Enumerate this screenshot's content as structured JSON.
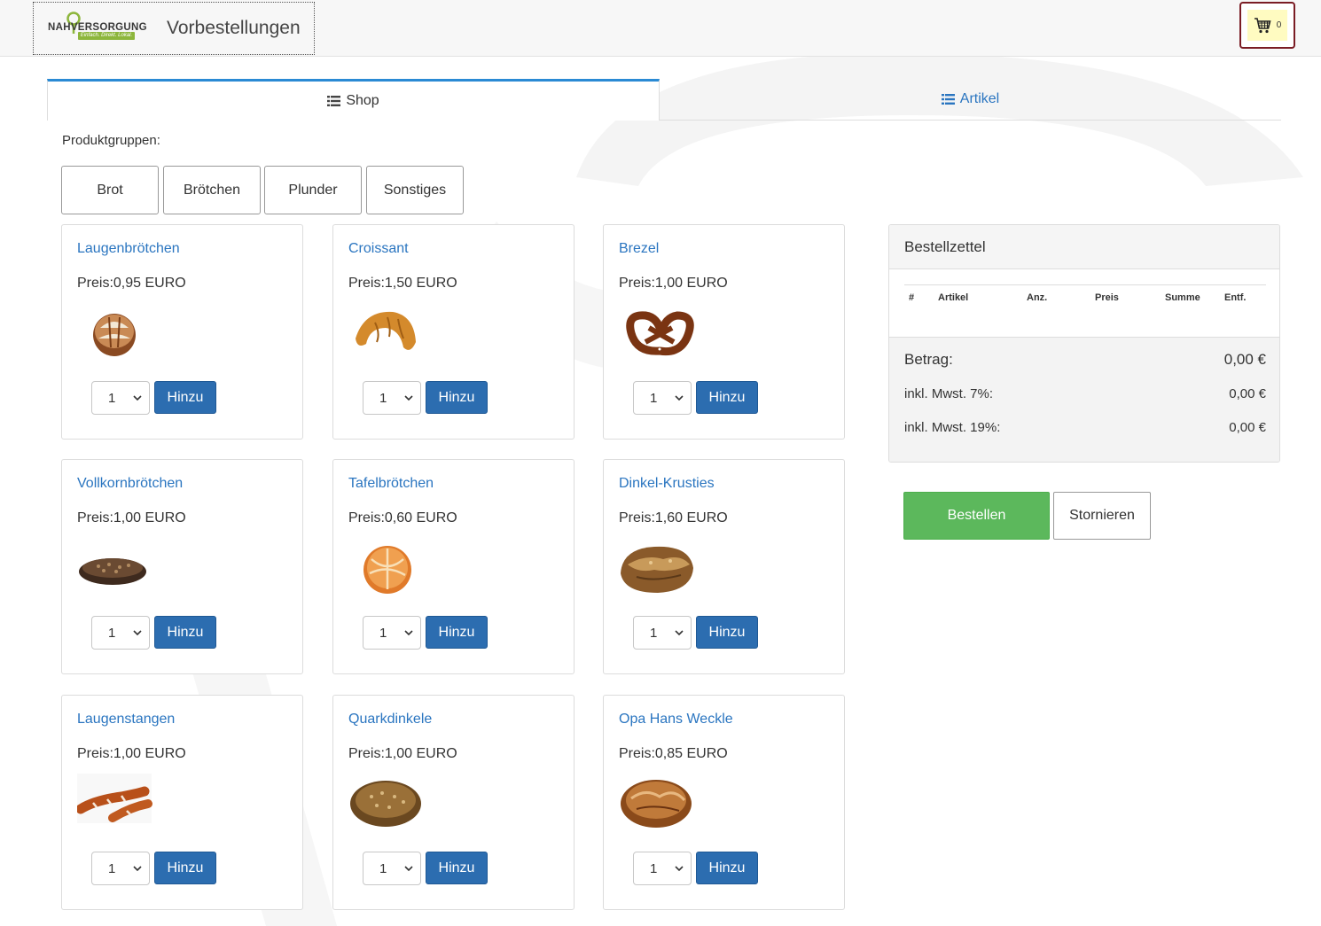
{
  "header": {
    "logo_text": "NAHVERSORGUNG",
    "logo_tagline": "Einfach. Direkt. Lokal.",
    "title": "Vorbestellungen",
    "cart_count": "0"
  },
  "tabs": [
    {
      "label": "Shop",
      "active": true
    },
    {
      "label": "Artikel",
      "active": false
    }
  ],
  "groups": {
    "label": "Produktgruppen:",
    "items": [
      "Brot",
      "Brötchen",
      "Plunder",
      "Sonstiges"
    ]
  },
  "products": [
    {
      "name": "Laugenbrötchen",
      "price": "Preis:0,95 EURO",
      "qty": "1",
      "add_label": "Hinzu",
      "image": "laugenbroetchen"
    },
    {
      "name": "Croissant",
      "price": "Preis:1,50 EURO",
      "qty": "1",
      "add_label": "Hinzu",
      "image": "croissant"
    },
    {
      "name": "Brezel",
      "price": "Preis:1,00 EURO",
      "qty": "1",
      "add_label": "Hinzu",
      "image": "brezel"
    },
    {
      "name": "Vollkornbrötchen",
      "price": "Preis:1,00 EURO",
      "qty": "1",
      "add_label": "Hinzu",
      "image": "vollkornbroetchen"
    },
    {
      "name": "Tafelbrötchen",
      "price": "Preis:0,60 EURO",
      "qty": "1",
      "add_label": "Hinzu",
      "image": "tafelbroetchen"
    },
    {
      "name": "Dinkel-Krusties",
      "price": "Preis:1,60 EURO",
      "qty": "1",
      "add_label": "Hinzu",
      "image": "dinkel-krusties"
    },
    {
      "name": "Laugenstangen",
      "price": "Preis:1,00 EURO",
      "qty": "1",
      "add_label": "Hinzu",
      "image": "laugenstangen"
    },
    {
      "name": "Quarkdinkele",
      "price": "Preis:1,00 EURO",
      "qty": "1",
      "add_label": "Hinzu",
      "image": "quarkdinkele"
    },
    {
      "name": "Opa Hans Weckle",
      "price": "Preis:0,85 EURO",
      "qty": "1",
      "add_label": "Hinzu",
      "image": "opa-hans-weckle"
    }
  ],
  "order": {
    "title": "Bestellzettel",
    "columns": [
      "#",
      "Artikel",
      "Anz.",
      "Preis",
      "Summe",
      "Entf."
    ],
    "total_label": "Betrag:",
    "total_value": "0,00 €",
    "vat7_label": "inkl. Mwst. 7%:",
    "vat7_value": "0,00 €",
    "vat19_label": "inkl. Mwst. 19%:",
    "vat19_value": "0,00 €",
    "submit_label": "Bestellen",
    "cancel_label": "Stornieren"
  },
  "colors": {
    "accent": "#2a75c0",
    "button_primary": "#2c6db0",
    "button_success": "#5cb85c",
    "cart_border": "#7a1c24",
    "cart_bg": "#fffbc1",
    "brand_green": "#8db63c"
  }
}
